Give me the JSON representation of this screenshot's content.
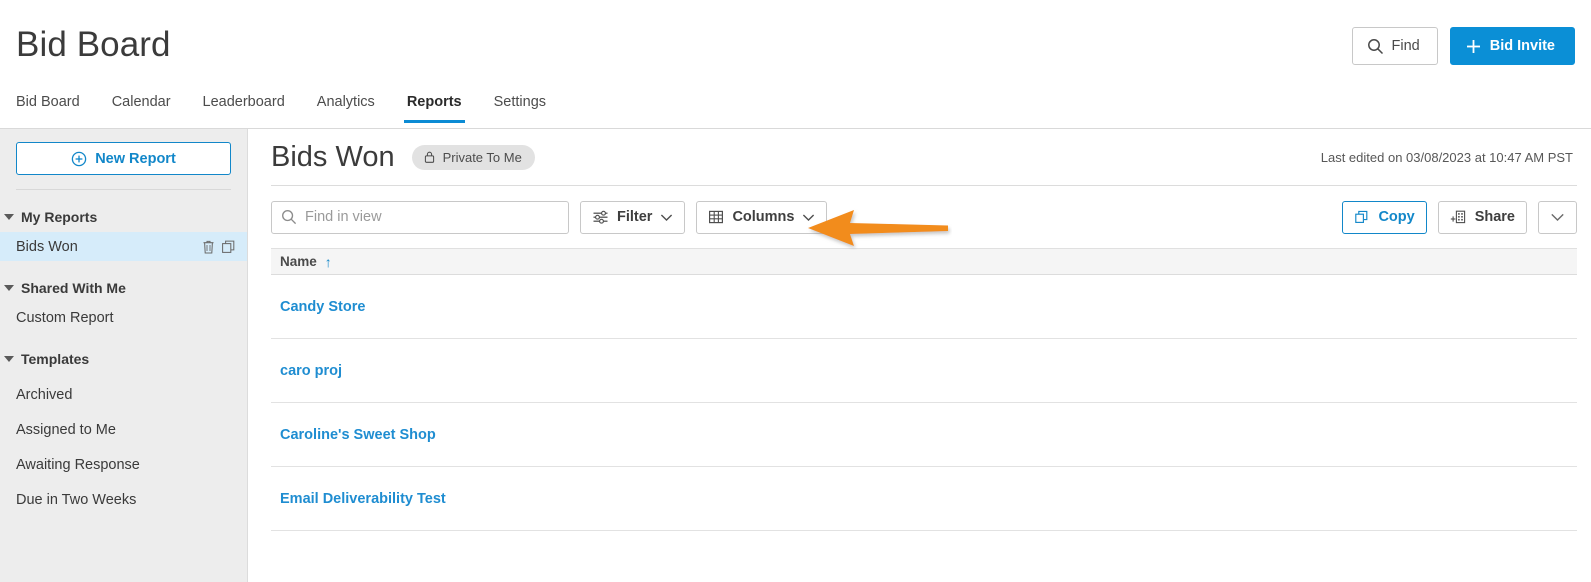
{
  "header": {
    "app_title": "Bid Board",
    "find_label": "Find",
    "bid_invite_label": "Bid Invite"
  },
  "tabs": [
    {
      "label": "Bid Board",
      "active": false
    },
    {
      "label": "Calendar",
      "active": false
    },
    {
      "label": "Leaderboard",
      "active": false
    },
    {
      "label": "Analytics",
      "active": false
    },
    {
      "label": "Reports",
      "active": true
    },
    {
      "label": "Settings",
      "active": false
    }
  ],
  "sidebar": {
    "new_report_label": "New Report",
    "groups": [
      {
        "label": "My Reports",
        "items": [
          {
            "label": "Bids Won",
            "selected": true,
            "icons": [
              "trash-icon",
              "duplicate-icon"
            ]
          }
        ]
      },
      {
        "label": "Shared With Me",
        "items": [
          {
            "label": "Custom Report",
            "selected": false,
            "icons": []
          }
        ]
      },
      {
        "label": "Templates",
        "items": [
          {
            "label": "Archived",
            "selected": false,
            "icons": []
          },
          {
            "label": "Assigned to Me",
            "selected": false,
            "icons": []
          },
          {
            "label": "Awaiting Response",
            "selected": false,
            "icons": []
          },
          {
            "label": "Due in Two Weeks",
            "selected": false,
            "icons": []
          }
        ]
      }
    ]
  },
  "report": {
    "title": "Bids Won",
    "visibility_badge": "Private To Me",
    "last_edited": "Last edited on 03/08/2023 at 10:47 AM PST"
  },
  "toolbar": {
    "search_placeholder": "Find in view",
    "search_value": "",
    "filter_label": "Filter",
    "columns_label": "Columns",
    "copy_label": "Copy",
    "share_label": "Share",
    "more_label": ""
  },
  "table": {
    "sort_indicator": "↑",
    "columns": [
      "Name"
    ],
    "rows": [
      {
        "name": "Candy Store"
      },
      {
        "name": "caro proj"
      },
      {
        "name": "Caroline's Sweet Shop"
      },
      {
        "name": "Email Deliverability Test"
      },
      {
        "name": ""
      }
    ]
  },
  "annotation": {
    "type": "arrow-left",
    "color": "#F28C1E"
  },
  "colors": {
    "accent_blue": "#0b8fd6",
    "link_blue": "#1f8dd1",
    "sidebar_bg": "#ededed",
    "selected_row": "#d6ecfa",
    "arrow_orange": "#F28C1E"
  }
}
